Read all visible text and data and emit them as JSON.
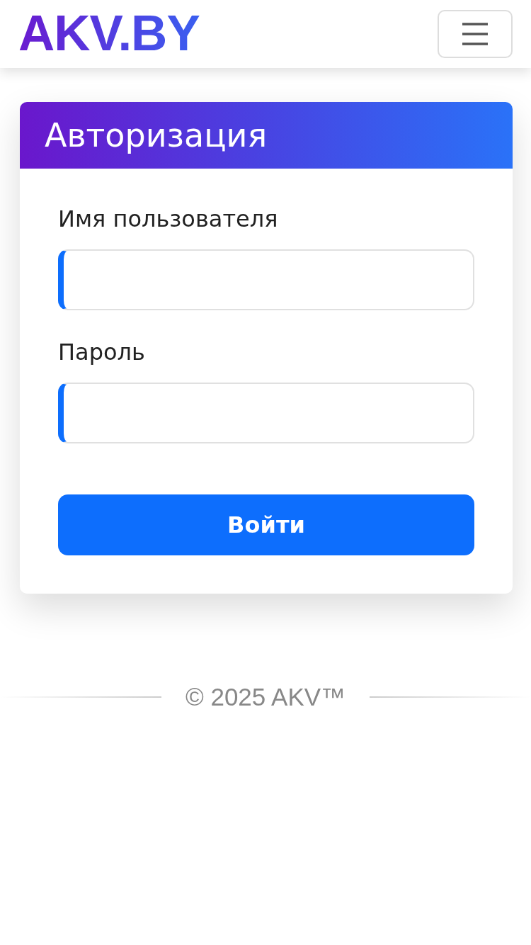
{
  "header": {
    "logo": "AKV.BY"
  },
  "card": {
    "title": "Авторизация",
    "fields": [
      {
        "label": "Имя пользователя"
      },
      {
        "label": "Пароль"
      }
    ],
    "submit": "Войти"
  },
  "footer": {
    "text": "© 2025 AKV™"
  }
}
